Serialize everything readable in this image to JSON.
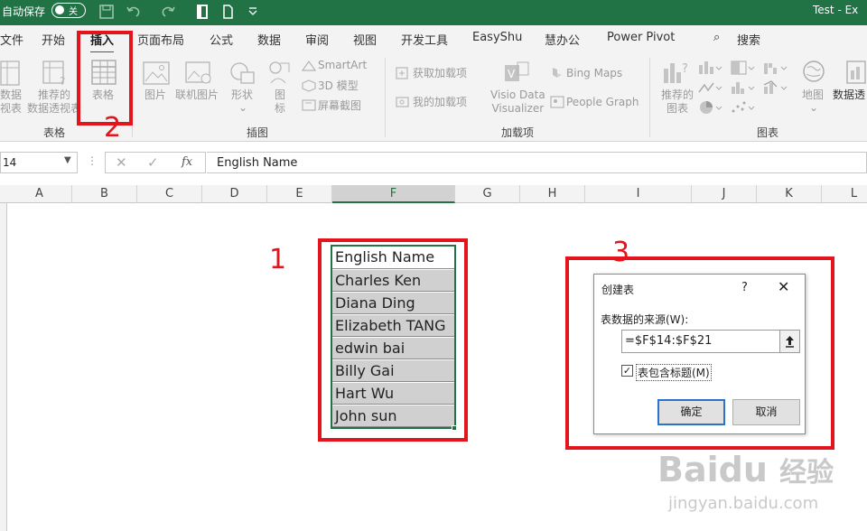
{
  "titlebar": {
    "autosave_label": "自动保存",
    "autosave_state": "关",
    "title_right": "Test  -  Ex"
  },
  "tabs": [
    "文件",
    "开始",
    "插入",
    "页面布局",
    "公式",
    "数据",
    "审阅",
    "视图",
    "开发工具",
    "EasyShu",
    "慧办公",
    "Power Pivot",
    "搜索"
  ],
  "ribbon": {
    "pivot_label": [
      "数据",
      "视表"
    ],
    "rec_pivot_label": [
      "推荐的",
      "数据透视表"
    ],
    "table_label": "表格",
    "picture_label": "图片",
    "online_picture_label": "联机图片",
    "shapes_label": "形状",
    "icons_label": [
      "图",
      "标"
    ],
    "smartart_label": "SmartArt",
    "model3d_label": "3D 模型",
    "screenshot_label": "屏幕截图",
    "get_addins_label": "获取加载项",
    "my_addins_label": "我的加载项",
    "visio_label": [
      "Visio Data",
      "Visualizer"
    ],
    "bing_maps_label": "Bing Maps",
    "people_graph_label": "People Graph",
    "rec_charts_label": [
      "推荐的",
      "图表"
    ],
    "map_label": "地图",
    "pivot_chart_label": "数据透",
    "groups": {
      "tables": "表格",
      "illustrations": "插图",
      "addins": "加载项",
      "charts": "图表"
    }
  },
  "formula_bar": {
    "name_box": "14",
    "formula": "English Name"
  },
  "columns": [
    "A",
    "B",
    "C",
    "D",
    "E",
    "F",
    "G",
    "H",
    "I",
    "J",
    "K",
    "L"
  ],
  "table": {
    "header": "English Name",
    "rows": [
      "Charles Ken",
      "Diana Ding",
      "Elizabeth TANG",
      "edwin bai",
      "Billy Gai",
      "Hart Wu",
      "John sun"
    ]
  },
  "annotations": {
    "n1": "1",
    "n2": "2",
    "n3": "3",
    "color": "#e3141c"
  },
  "dialog": {
    "title": "创建表",
    "help": "?",
    "source_label": "表数据的来源(W):",
    "source_value": "=$F$14:$F$21",
    "has_headers_label": "表包含标题(M)",
    "ok_label": "确定",
    "cancel_label": "取消"
  },
  "watermark": {
    "brand": "Baidu",
    "brand_cn": "经验",
    "url": "jingyan.baidu.com"
  },
  "colors": {
    "excel_green": "#217346",
    "ribbon_bg": "#f3f3f3"
  }
}
